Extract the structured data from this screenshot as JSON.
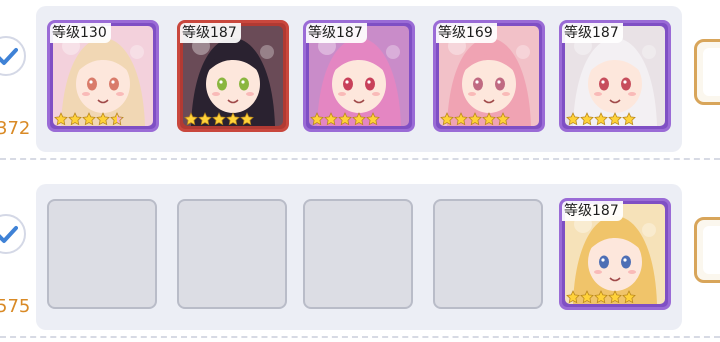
{
  "team_rows": [
    {
      "power_partial": "372",
      "units": [
        {
          "level_prefix": "等级",
          "level": "130",
          "stars": 5,
          "star_partial": true,
          "frame": "purple",
          "palette": {
            "bg": "#f3d1dc",
            "hair": "#f1d7b4",
            "eye": "#d97b6a"
          }
        },
        {
          "level_prefix": "等级",
          "level": "187",
          "stars": 5,
          "frame": "red",
          "palette": {
            "bg": "#6a4b57",
            "hair": "#2a2230",
            "eye": "#8ab63f"
          }
        },
        {
          "level_prefix": "等级",
          "level": "187",
          "stars": 5,
          "frame": "purple",
          "palette": {
            "bg": "#c98cc9",
            "hair": "#e486c2",
            "eye": "#c8405a"
          }
        },
        {
          "level_prefix": "等级",
          "level": "169",
          "stars": 5,
          "frame": "purple",
          "palette": {
            "bg": "#f2c1c8",
            "hair": "#f0a3b3",
            "eye": "#c06a82"
          }
        },
        {
          "level_prefix": "等级",
          "level": "187",
          "stars": 5,
          "frame": "purple",
          "palette": {
            "bg": "#e9e2e6",
            "hair": "#f3f0f3",
            "eye": "#c74d5c"
          }
        }
      ]
    },
    {
      "power_partial": "575",
      "units": [
        {
          "empty": true
        },
        {
          "empty": true
        },
        {
          "empty": true
        },
        {
          "empty": true
        },
        {
          "level_prefix": "等级",
          "level": "187",
          "stars": 5,
          "frame": "purple",
          "palette": {
            "bg": "#f6e2b9",
            "hair": "#f0c46a",
            "eye": "#4d6fb5"
          }
        }
      ]
    }
  ],
  "colors": {
    "card_bg": "#eceef5",
    "power_text": "#d98a26",
    "frame_purple": "#9a6bd6",
    "frame_red": "#c9473d",
    "star": "#ffd23a",
    "empty_slot": "#dcdde4"
  },
  "icons": {
    "check": "checkmark-icon",
    "star": "star-icon"
  }
}
